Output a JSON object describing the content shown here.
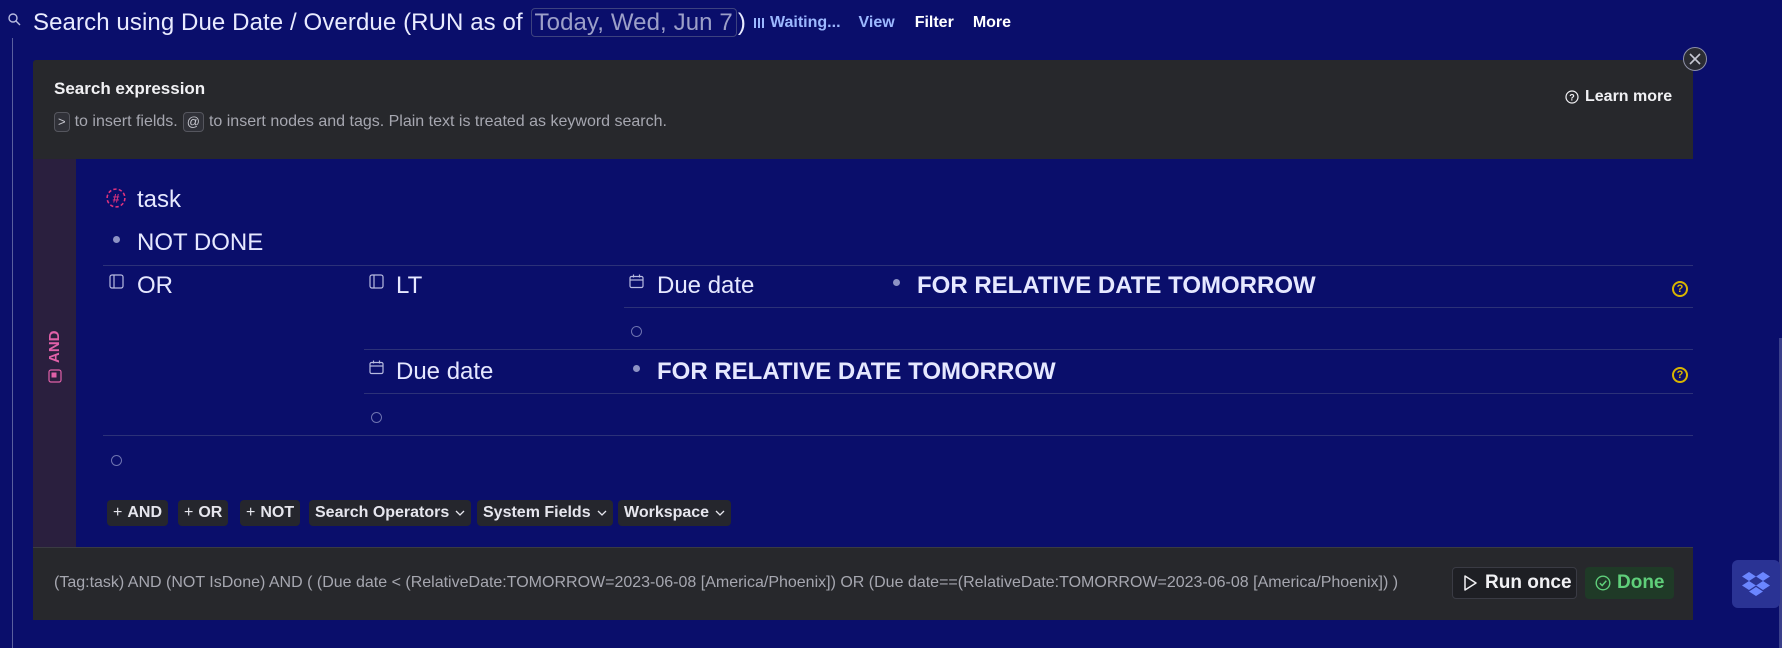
{
  "header": {
    "title_before": "Search using Due Date / Overdue (RUN as of",
    "date_chip": "Today, Wed, Jun 7",
    "title_after": ")",
    "waiting": "Waiting...",
    "view": "View",
    "filter": "Filter",
    "more": "More"
  },
  "panel": {
    "title": "Search expression",
    "hint_key1": ">",
    "hint_text1": "to insert fields.",
    "hint_key2": "@",
    "hint_text2": "to insert nodes and tags. Plain text is treated as keyword search.",
    "learn_more": "Learn more"
  },
  "query": {
    "root_operator": "AND",
    "tag": "task",
    "not_done": "NOT DONE",
    "or_label": "OR",
    "lt_label": "LT",
    "field1": "Due date",
    "value1": "FOR RELATIVE DATE TOMORROW",
    "field2": "Due date",
    "value2": "FOR RELATIVE DATE TOMORROW"
  },
  "actions": {
    "and": "AND",
    "or": "OR",
    "not": "NOT",
    "search_operators": "Search Operators",
    "system_fields": "System Fields",
    "workspace": "Workspace"
  },
  "footer": {
    "expression": "(Tag:task) AND (NOT IsDone) AND ( (Due date < (RelativeDate:TOMORROW=2023-06-08 [America/Phoenix]) OR (Due date==(RelativeDate:TOMORROW=2023-06-08 [America/Phoenix]) )",
    "run_once": "Run once",
    "done": "Done"
  },
  "colors": {
    "background": "#0a0e6b",
    "panel": "#27282c",
    "tag_pink": "#e0337d",
    "help_yellow": "#d8b400",
    "done_green": "#5fcf7a"
  },
  "icons": [
    "search-icon",
    "waiting-icon",
    "close-icon",
    "help-circle-icon",
    "tag-hash-icon",
    "or-node-icon",
    "lt-node-icon",
    "calendar-icon",
    "chevron-down-icon",
    "play-icon",
    "check-circle-icon",
    "dropbox-icon"
  ]
}
